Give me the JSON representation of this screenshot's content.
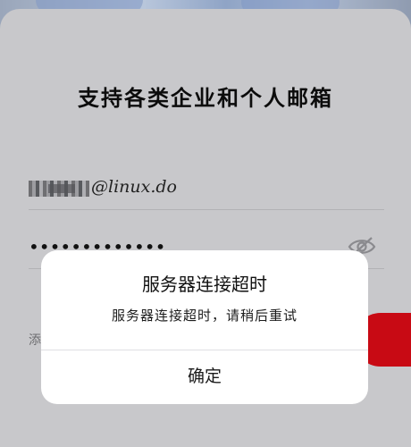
{
  "login_card": {
    "title": "支持各类企业和个人邮箱",
    "email_value": "@linux.do",
    "password_masked": "•••••••••••••",
    "add_label": "添"
  },
  "dialog": {
    "title": "服务器连接超时",
    "message": "服务器连接超时，请稍后重试",
    "confirm_label": "确定"
  },
  "icons": {
    "password_toggle": "eye-off-icon"
  },
  "colors": {
    "accent_red": "#c80a14",
    "dialog_bg": "#ffffff",
    "overlay_card": "#c8c8cb"
  }
}
